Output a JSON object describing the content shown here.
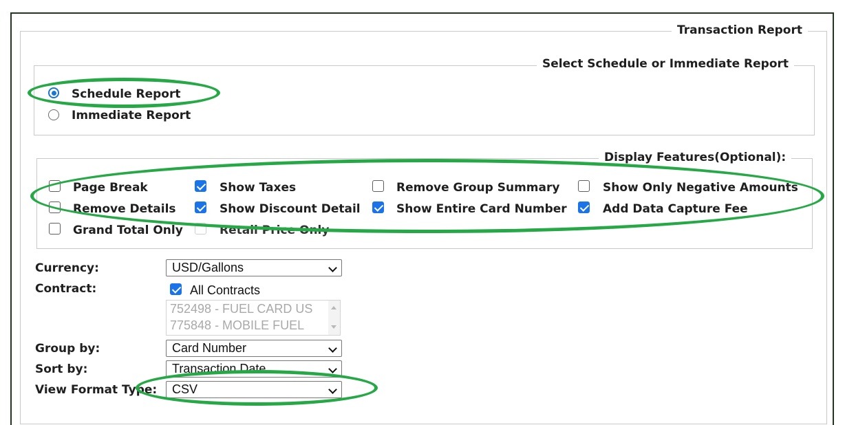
{
  "report": {
    "title": "Transaction Report",
    "schedule_section": {
      "legend": "Select Schedule or Immediate Report",
      "options": [
        {
          "label": "Schedule Report",
          "selected": true
        },
        {
          "label": "Immediate Report",
          "selected": false
        }
      ]
    },
    "display_features": {
      "legend": "Display Features(Optional):",
      "items": [
        {
          "label": "Page Break",
          "checked": false
        },
        {
          "label": "Show Taxes",
          "checked": true
        },
        {
          "label": "Remove Group Summary",
          "checked": false
        },
        {
          "label": "Show Only Negative Amounts",
          "checked": false
        },
        {
          "label": "Remove Details",
          "checked": false
        },
        {
          "label": "Show Discount Detail",
          "checked": true
        },
        {
          "label": "Show Entire Card Number",
          "checked": true
        },
        {
          "label": "Add Data Capture Fee",
          "checked": true
        },
        {
          "label": "Grand Total Only",
          "checked": false
        },
        {
          "label": "Retail Price Only",
          "checked": false,
          "disabled": true
        }
      ]
    },
    "form": {
      "currency_label": "Currency:",
      "currency_value": "USD/Gallons",
      "contract_label": "Contract:",
      "all_contracts_label": "All Contracts",
      "all_contracts_checked": true,
      "contracts": [
        "752498 - FUEL CARD US",
        "775848 - MOBILE FUEL"
      ],
      "group_by_label": "Group by:",
      "group_by_value": "Card Number",
      "sort_by_label": "Sort by:",
      "sort_by_value": "Transaction Date",
      "view_format_label": "View Format Type:",
      "view_format_value": "CSV"
    }
  },
  "colors": {
    "highlight": "#27a847",
    "frame_border": "#22361f",
    "checkbox_accent": "#1a73e8"
  }
}
